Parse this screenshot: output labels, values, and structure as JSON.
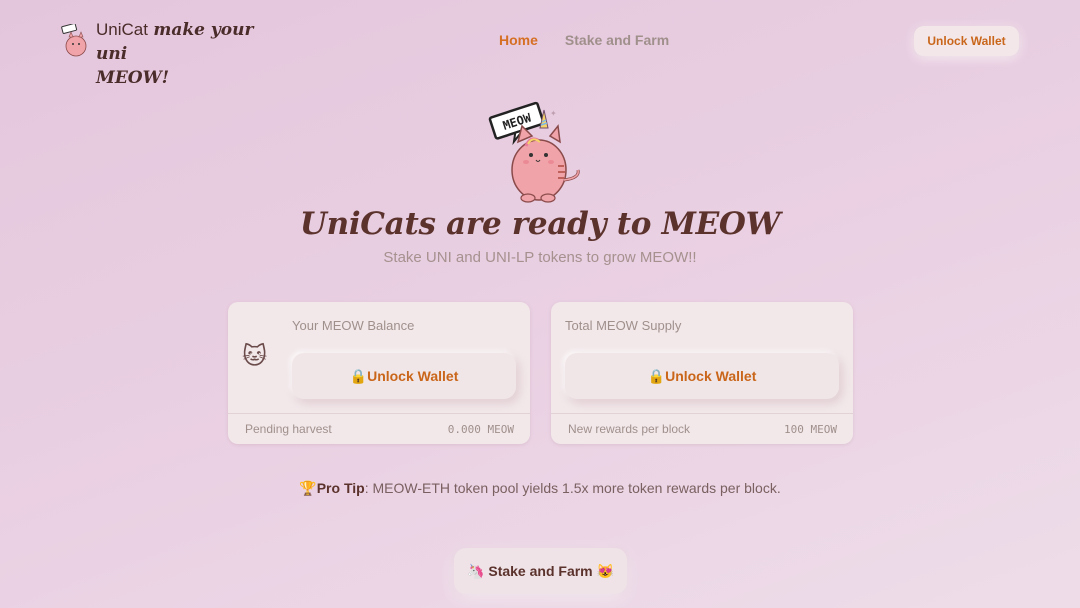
{
  "header": {
    "brand": "UniCat",
    "tagline_part1": "make your uni",
    "tagline_part2": "MEOW!",
    "nav": [
      {
        "label": "Home",
        "active": true
      },
      {
        "label": "Stake and Farm",
        "active": false
      }
    ],
    "wallet_button": "Unlock Wallet"
  },
  "hero": {
    "bubble_text": "MEOW",
    "title": "UniCats are ready to MEOW",
    "subtitle": "Stake UNI and UNI-LP tokens to grow MEOW!!"
  },
  "balance_card": {
    "label": "Your MEOW Balance",
    "emoji": "🐱",
    "lock_icon": "🔒",
    "button": "Unlock Wallet",
    "footer_label": "Pending harvest",
    "footer_value": "0.000 MEOW"
  },
  "supply_card": {
    "label": "Total MEOW Supply",
    "lock_icon": "🔒",
    "button": "Unlock Wallet",
    "footer_label": "New rewards per block",
    "footer_value": "100 MEOW"
  },
  "pro_tip": {
    "icon": "🏆",
    "title": "Pro Tip",
    "text": ": MEOW-ETH token pool yields 1.5x more token rewards per block."
  },
  "stake_button": {
    "icon_left": "🦄",
    "label": "Stake and Farm",
    "icon_right": "😻"
  },
  "colors": {
    "accent": "#d56f24",
    "title": "#5b322c",
    "muted": "#a0908c"
  }
}
